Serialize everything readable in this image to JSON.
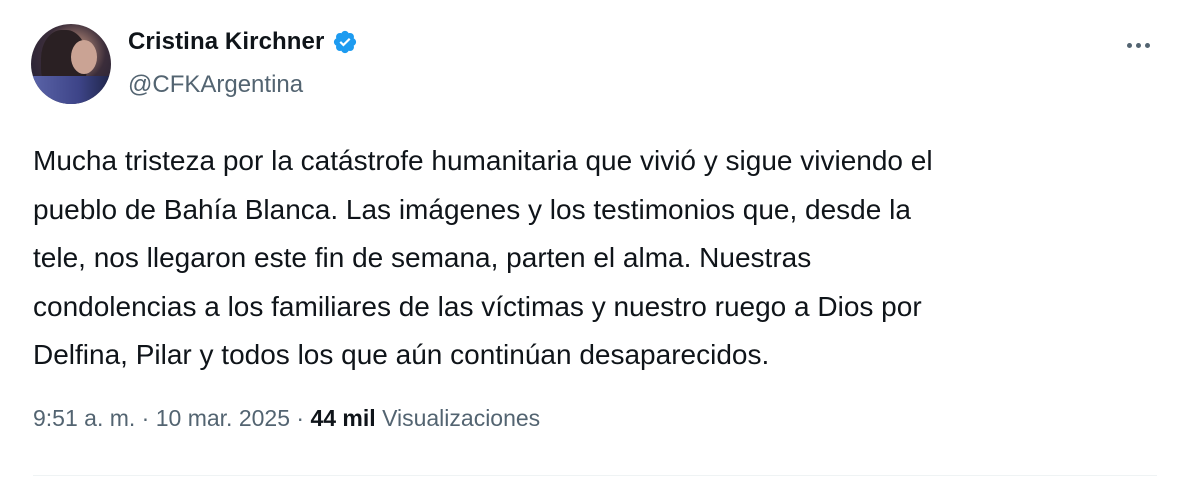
{
  "author": {
    "display_name": "Cristina Kirchner",
    "handle": "@CFKArgentina",
    "verified_icon": "verified-badge-icon",
    "verified_color": "#1d9bf0"
  },
  "tweet": {
    "text": "Mucha tristeza por la catástrofe humanitaria que vivió y sigue viviendo el\npueblo de Bahía Blanca. Las imágenes y los testimonios que, desde la\ntele, nos llegaron este fin de semana, parten el alma. Nuestras\ncondolencias a los familiares de las víctimas y nuestro ruego a Dios por\nDelfina, Pilar y todos los que aún continúan desaparecidos."
  },
  "meta": {
    "time": "9:51 a. m.",
    "separator": "·",
    "date": "10 mar. 2025",
    "views_count": "44 mil",
    "views_label": "Visualizaciones"
  },
  "icons": {
    "more": "more-options-icon"
  }
}
